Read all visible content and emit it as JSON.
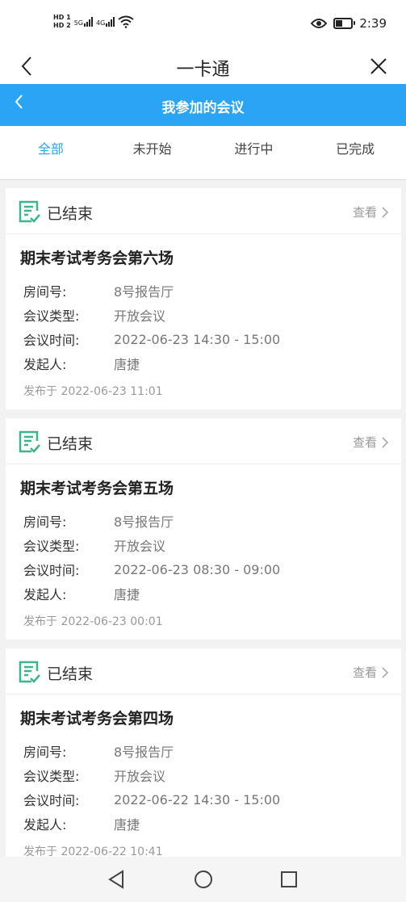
{
  "status_bar": {
    "hd1": "HD 1",
    "hd2": "HD 2",
    "sig1_label": "5G",
    "sig2_label": "4G",
    "time": "2:39",
    "icons": [
      "signal-icon",
      "wifi-icon",
      "eye-icon",
      "battery-icon"
    ]
  },
  "navbar": {
    "title": "一卡通"
  },
  "header": {
    "title": "我参加的会议"
  },
  "tabs": [
    {
      "label": "全部",
      "active": true
    },
    {
      "label": "未开始",
      "active": false
    },
    {
      "label": "进行中",
      "active": false
    },
    {
      "label": "已完成",
      "active": false
    }
  ],
  "meetings": [
    {
      "status": "已结束",
      "view": "查看",
      "title": "期末考试考务会第六场",
      "fields": [
        {
          "label": "房间号:",
          "value": "8号报告厅"
        },
        {
          "label": "会议类型:",
          "value": "开放会议"
        },
        {
          "label": "会议时间:",
          "value": "2022-06-23 14:30 - 15:00"
        },
        {
          "label": "发起人:",
          "value": "唐捷"
        }
      ],
      "published": "发布于 2022-06-23 11:01"
    },
    {
      "status": "已结束",
      "view": "查看",
      "title": "期末考试考务会第五场",
      "fields": [
        {
          "label": "房间号:",
          "value": "8号报告厅"
        },
        {
          "label": "会议类型:",
          "value": "开放会议"
        },
        {
          "label": "会议时间:",
          "value": "2022-06-23 08:30 - 09:00"
        },
        {
          "label": "发起人:",
          "value": "唐捷"
        }
      ],
      "published": "发布于 2022-06-23 00:01"
    },
    {
      "status": "已结束",
      "view": "查看",
      "title": "期末考试考务会第四场",
      "fields": [
        {
          "label": "房间号:",
          "value": "8号报告厅"
        },
        {
          "label": "会议类型:",
          "value": "开放会议"
        },
        {
          "label": "会议时间:",
          "value": "2022-06-22 14:30 - 15:00"
        },
        {
          "label": "发起人:",
          "value": "唐捷"
        }
      ],
      "published": "发布于 2022-06-22 10:41"
    }
  ],
  "colors": {
    "accent": "#2aa4f4",
    "status_icon": "#3bb58a",
    "background": "#f2f2f2"
  }
}
